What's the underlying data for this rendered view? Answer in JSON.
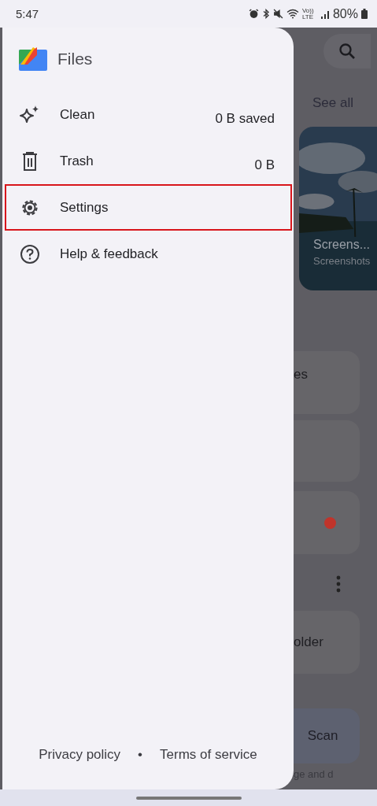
{
  "status_bar": {
    "time": "5:47",
    "volte": "Vo)) LTE",
    "battery": "80%"
  },
  "background": {
    "see_all": "See all",
    "album": {
      "title": "Screens...",
      "subtitle": "Screenshots"
    },
    "card_text": "es",
    "notification_dot": {
      "color": "#c0342b"
    },
    "folder_text": "older",
    "scan_button": "Scan",
    "footer_text": "ge and d"
  },
  "drawer": {
    "app_name": "Files",
    "items": [
      {
        "kind": "clean",
        "label": "Clean",
        "value": "0 B saved",
        "highlighted": false
      },
      {
        "kind": "trash",
        "label": "Trash",
        "value": "0 B",
        "highlighted": false
      },
      {
        "kind": "settings",
        "label": "Settings",
        "highlighted": true
      },
      {
        "kind": "help",
        "label": "Help & feedback",
        "highlighted": false
      }
    ],
    "footer": {
      "privacy": "Privacy policy",
      "separator": "•",
      "terms": "Terms of service"
    }
  }
}
